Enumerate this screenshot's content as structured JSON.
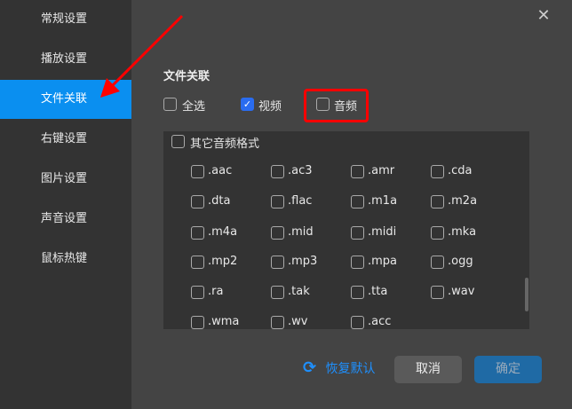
{
  "sidebar": {
    "items": [
      {
        "label": "常规设置"
      },
      {
        "label": "播放设置"
      },
      {
        "label": "文件关联"
      },
      {
        "label": "右键设置"
      },
      {
        "label": "图片设置"
      },
      {
        "label": "声音设置"
      },
      {
        "label": "鼠标热键"
      }
    ],
    "active": 2
  },
  "section_title": "文件关联",
  "filters": [
    {
      "label": "全选",
      "checked": false
    },
    {
      "label": "视频",
      "checked": true
    },
    {
      "label": "音频",
      "checked": false
    }
  ],
  "other_audio": {
    "label": "其它音频格式",
    "checked": false
  },
  "formats": [
    ".aac",
    ".ac3",
    ".amr",
    ".cda",
    ".dta",
    ".flac",
    ".m1a",
    ".m2a",
    ".m4a",
    ".mid",
    ".midi",
    ".mka",
    ".mp2",
    ".mp3",
    ".mpa",
    ".ogg",
    ".ra",
    ".tak",
    ".tta",
    ".wav",
    ".wma",
    ".wv",
    ".acc"
  ],
  "footer": {
    "restore": "恢复默认",
    "cancel": "取消",
    "ok": "确定"
  },
  "colors": {
    "accent": "#0a8ff0",
    "highlight": "#ff0000"
  }
}
